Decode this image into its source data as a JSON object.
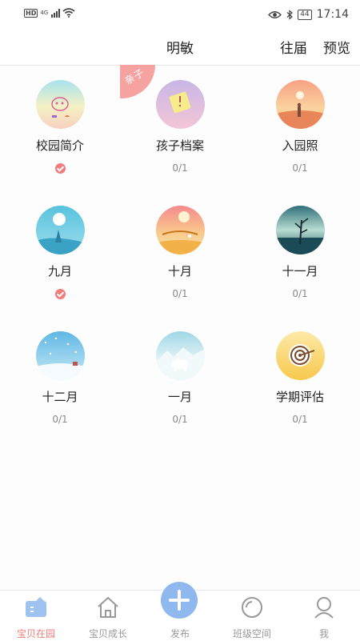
{
  "status_bar": {
    "hd": "HD",
    "network": "4G",
    "battery": "44",
    "time": "17:14"
  },
  "header": {
    "title": "明敏",
    "past_label": "往届",
    "preview_label": "预览"
  },
  "ribbon": {
    "label": "亲子"
  },
  "items": [
    {
      "label": "校园简介",
      "done": true,
      "status": ""
    },
    {
      "label": "孩子档案",
      "done": false,
      "status": "0/1"
    },
    {
      "label": "入园照",
      "done": false,
      "status": "0/1"
    },
    {
      "label": "九月",
      "done": true,
      "status": ""
    },
    {
      "label": "十月",
      "done": false,
      "status": "0/1"
    },
    {
      "label": "十一月",
      "done": false,
      "status": "0/1"
    },
    {
      "label": "十二月",
      "done": false,
      "status": "0/1"
    },
    {
      "label": "一月",
      "done": false,
      "status": "0/1"
    },
    {
      "label": "学期评估",
      "done": false,
      "status": "0/1"
    }
  ],
  "nav": [
    {
      "label": "宝贝在园",
      "icon": "class-home-icon",
      "active": true
    },
    {
      "label": "宝贝成长",
      "icon": "house-icon",
      "active": false
    },
    {
      "label": "发布",
      "icon": "plus-icon",
      "active": false
    },
    {
      "label": "班级空间",
      "icon": "circle-icon",
      "active": false
    },
    {
      "label": "我",
      "icon": "person-icon",
      "active": false
    }
  ],
  "colors": {
    "accent": "#ef7d7d",
    "fab": "#8fb8ee",
    "ribbon": "#f5a2a0"
  }
}
